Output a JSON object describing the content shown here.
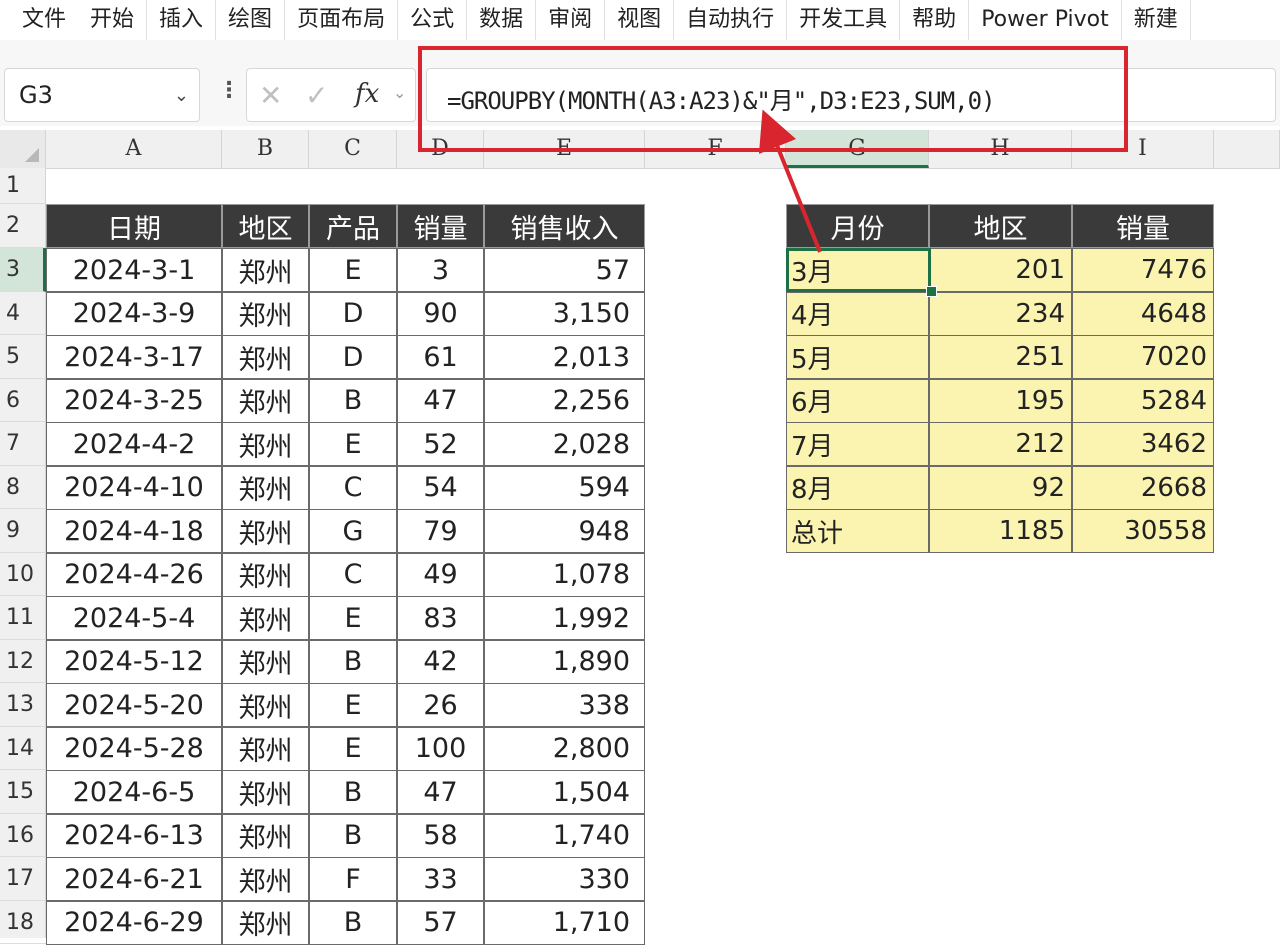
{
  "menu": [
    "文件",
    "开始",
    "插入",
    "绘图",
    "页面布局",
    "公式",
    "数据",
    "审阅",
    "视图",
    "自动执行",
    "开发工具",
    "帮助",
    "Power Pivot",
    "新建"
  ],
  "formula_bar": {
    "name_box": "G3",
    "colon": "⋮",
    "cancel_glyph": "✕",
    "confirm_glyph": "✓",
    "fx_label": "fx",
    "formula": "=GROUPBY(MONTH(A3:A23)&\"月\",D3:E23,SUM,0)"
  },
  "columns": [
    "A",
    "B",
    "C",
    "D",
    "E",
    "F",
    "G",
    "H",
    "I"
  ],
  "rows": [
    "1",
    "2",
    "3",
    "4",
    "5",
    "6",
    "7",
    "8",
    "9",
    "10",
    "11",
    "12",
    "13",
    "14",
    "15",
    "16",
    "17",
    "18"
  ],
  "source_table": {
    "headers": [
      "日期",
      "地区",
      "产品",
      "销量",
      "销售收入"
    ],
    "rows": [
      [
        "2024-3-1",
        "郑州",
        "E",
        "3",
        "57"
      ],
      [
        "2024-3-9",
        "郑州",
        "D",
        "90",
        "3,150"
      ],
      [
        "2024-3-17",
        "郑州",
        "D",
        "61",
        "2,013"
      ],
      [
        "2024-3-25",
        "郑州",
        "B",
        "47",
        "2,256"
      ],
      [
        "2024-4-2",
        "郑州",
        "E",
        "52",
        "2,028"
      ],
      [
        "2024-4-10",
        "郑州",
        "C",
        "54",
        "594"
      ],
      [
        "2024-4-18",
        "郑州",
        "G",
        "79",
        "948"
      ],
      [
        "2024-4-26",
        "郑州",
        "C",
        "49",
        "1,078"
      ],
      [
        "2024-5-4",
        "郑州",
        "E",
        "83",
        "1,992"
      ],
      [
        "2024-5-12",
        "郑州",
        "B",
        "42",
        "1,890"
      ],
      [
        "2024-5-20",
        "郑州",
        "E",
        "26",
        "338"
      ],
      [
        "2024-5-28",
        "郑州",
        "E",
        "100",
        "2,800"
      ],
      [
        "2024-6-5",
        "郑州",
        "B",
        "47",
        "1,504"
      ],
      [
        "2024-6-13",
        "郑州",
        "B",
        "58",
        "1,740"
      ],
      [
        "2024-6-21",
        "郑州",
        "F",
        "33",
        "330"
      ],
      [
        "2024-6-29",
        "郑州",
        "B",
        "57",
        "1,710"
      ]
    ]
  },
  "result_table": {
    "headers": [
      "月份",
      "地区",
      "销量"
    ],
    "rows": [
      [
        "3月",
        "201",
        "7476"
      ],
      [
        "4月",
        "234",
        "4648"
      ],
      [
        "5月",
        "251",
        "7020"
      ],
      [
        "6月",
        "195",
        "5284"
      ],
      [
        "7月",
        "212",
        "3462"
      ],
      [
        "8月",
        "92",
        "2668"
      ],
      [
        "总计",
        "1185",
        "30558"
      ]
    ]
  },
  "colors": {
    "header_bg": "#3a3a3a",
    "result_fill": "#fbf4b0",
    "highlight": "#d9262e",
    "selection": "#1e7145"
  }
}
